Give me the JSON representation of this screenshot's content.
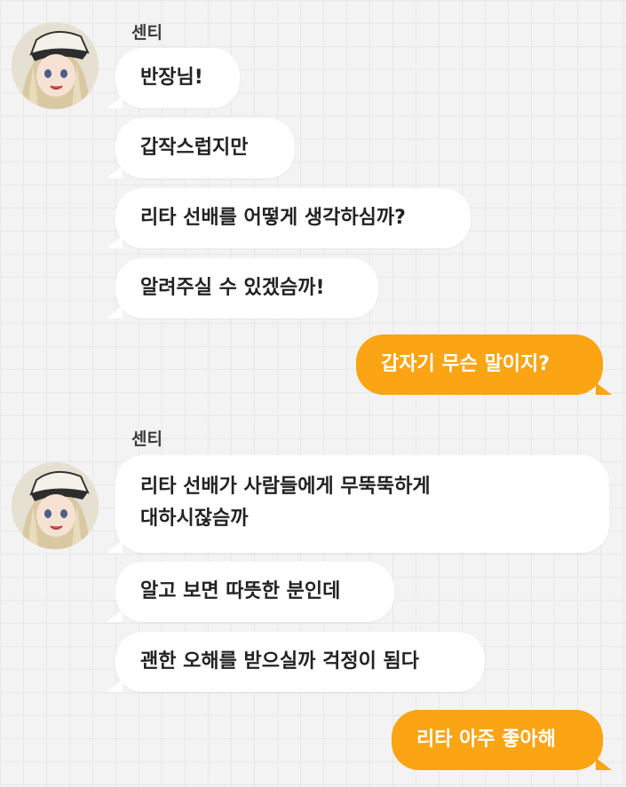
{
  "chat": {
    "groups": [
      {
        "sender": "센티",
        "messages": [
          "반장님!",
          "갑작스럽지만",
          "리타 선배를 어떻게 생각하심까?",
          "알려주실 수 있겠슴까!"
        ]
      },
      {
        "sender": "센티",
        "messages": [
          "리타 선배가 사람들에게 무뚝뚝하게",
          "대하시잖슴까",
          "알고 보면 따뜻한 분인데",
          "괜한 오해를 받으실까 걱정이 됨다"
        ]
      }
    ],
    "replies": [
      "갑자기 무슨 말이지?",
      "리타 아주 좋아해"
    ]
  },
  "colors": {
    "background": "#f3f3f3",
    "incoming_bubble": "#ffffff",
    "outgoing_bubble": "#fba414",
    "outgoing_text": "#ffffff"
  }
}
